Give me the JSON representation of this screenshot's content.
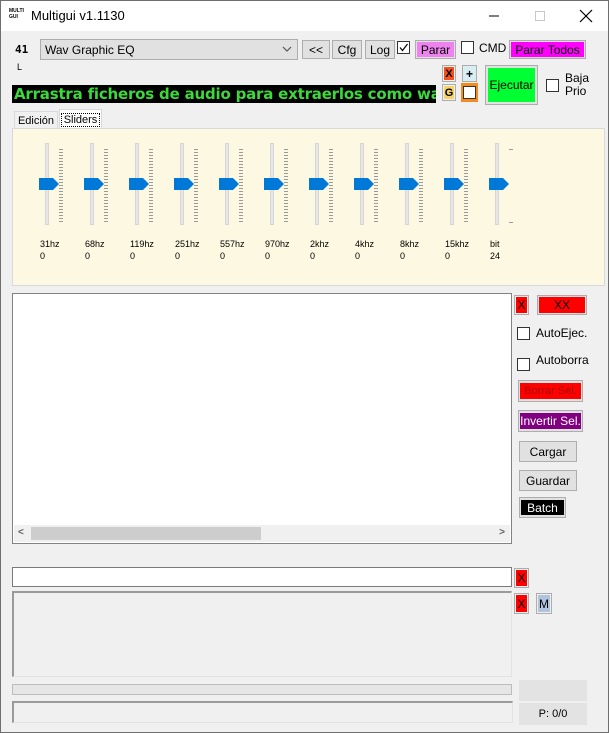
{
  "window": {
    "logo_line1": "MULTI",
    "logo_line2": "GUI",
    "title": "Multigui v1.1130",
    "controls": {
      "minimize": "—",
      "maximize": "☐",
      "close": "✕"
    }
  },
  "toolbar": {
    "counter": "41",
    "counter_sub": "L",
    "preset_selected": "Wav Graphic EQ",
    "back_label": "<<",
    "cfg_label": "Cfg",
    "log_label": "Log",
    "log_checked": true,
    "parar_label": "Parar",
    "cmd_label": "CMD",
    "cmd_checked": false,
    "parar_todos_label": "Parar Todos",
    "x_label": "X",
    "g_label": "G",
    "plus_label": "+",
    "ejecutar_label": "Ejecutar",
    "baja_prio_line1": "Baja",
    "baja_prio_line2": "Prio",
    "baja_prio_checked": false
  },
  "drop_banner": "Arrastra ficheros de audio para extraerlos como wav",
  "tabs": [
    {
      "label": "Edición",
      "active": false
    },
    {
      "label": "Sliders",
      "active": true
    }
  ],
  "sliders": [
    {
      "label": "31hz",
      "value": "0"
    },
    {
      "label": "68hz",
      "value": "0"
    },
    {
      "label": "119hz",
      "value": "0"
    },
    {
      "label": "251hz",
      "value": "0"
    },
    {
      "label": "557hz",
      "value": "0"
    },
    {
      "label": "970hz",
      "value": "0"
    },
    {
      "label": "2khz",
      "value": "0"
    },
    {
      "label": "4khz",
      "value": "0"
    },
    {
      "label": "8khz",
      "value": "0"
    },
    {
      "label": "15khz",
      "value": "0"
    },
    {
      "label": "bit",
      "value": "24"
    }
  ],
  "file_list": {
    "items": [],
    "scroll_left": "<",
    "scroll_right": ">"
  },
  "side_panel": {
    "x_label": "X",
    "xx_label": "XX",
    "auto_ejec_label": "AutoEjec.",
    "auto_ejec_checked": false,
    "autoborra_label": "Autoborra",
    "autoborra_checked": false,
    "borrar_sel_label": "Borrar Sel.",
    "invertir_sel_label": "Invertir Sel.",
    "cargar_label": "Cargar",
    "guardar_label": "Guardar",
    "batch_label": "Batch"
  },
  "bottom": {
    "command_input_value": "",
    "x1_label": "X",
    "x2_label": "X",
    "m_label": "M",
    "progress_percent": 0,
    "page_counter": "P: 0/0"
  },
  "colors": {
    "banner_bg": "#000000",
    "banner_text": "#3cd83c",
    "panel_bg": "#fdf8e1",
    "slider_thumb": "#0078d7",
    "red": "#ff0000",
    "purple": "#800080",
    "magenta": "#ff00ff",
    "violet": "#ee82ee",
    "green": "#00ff33",
    "orange": "#f58a1f"
  }
}
